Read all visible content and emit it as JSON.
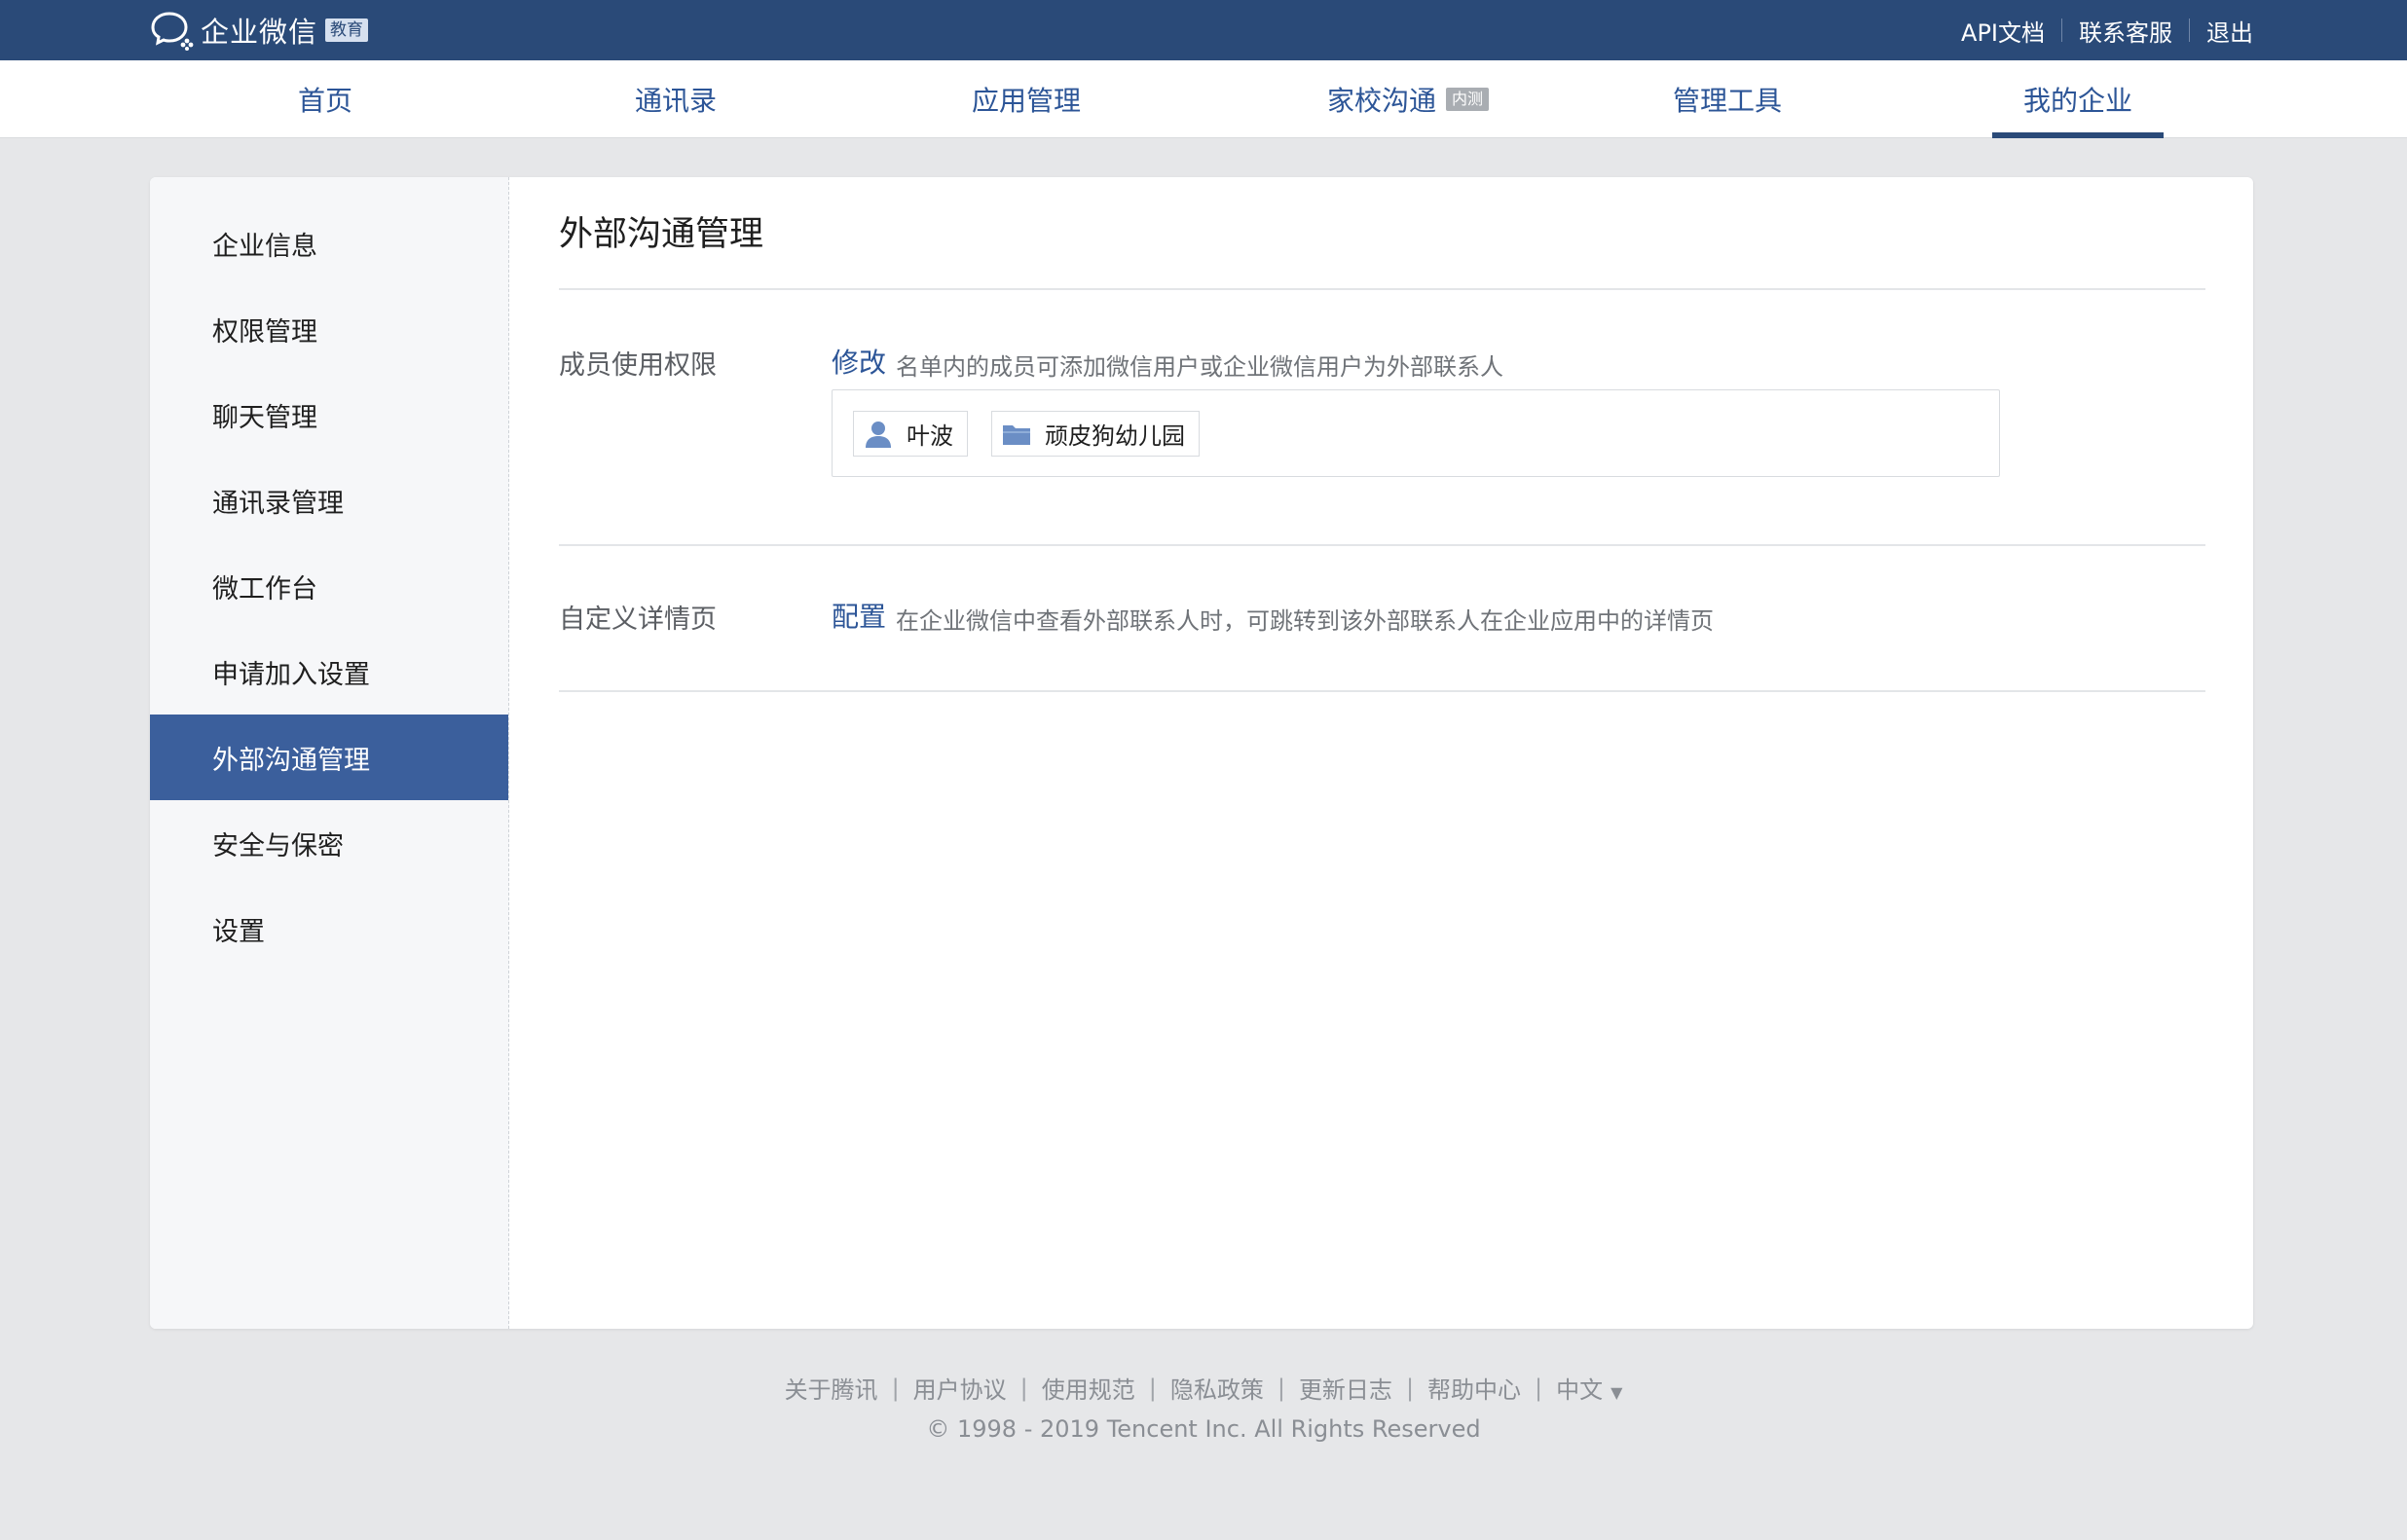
{
  "header": {
    "brand_name": "企业微信",
    "brand_badge": "教育",
    "links": [
      "API文档",
      "联系客服",
      "退出"
    ]
  },
  "nav": {
    "tabs": [
      {
        "label": "首页",
        "tag": ""
      },
      {
        "label": "通讯录",
        "tag": ""
      },
      {
        "label": "应用管理",
        "tag": ""
      },
      {
        "label": "家校沟通",
        "tag": "内测"
      },
      {
        "label": "管理工具",
        "tag": ""
      },
      {
        "label": "我的企业",
        "tag": ""
      }
    ],
    "active_tab": "我的企业"
  },
  "sidebar": {
    "items": [
      {
        "label": "企业信息"
      },
      {
        "label": "权限管理"
      },
      {
        "label": "聊天管理"
      },
      {
        "label": "通讯录管理"
      },
      {
        "label": "微工作台"
      },
      {
        "label": "申请加入设置"
      },
      {
        "label": "外部沟通管理"
      },
      {
        "label": "安全与保密"
      },
      {
        "label": "设置"
      }
    ],
    "active_item": "外部沟通管理"
  },
  "main": {
    "title": "外部沟通管理",
    "member_permission": {
      "label": "成员使用权限",
      "action": "修改",
      "description": "名单内的成员可添加微信用户或企业微信用户为外部联系人",
      "members": [
        {
          "name": "叶波",
          "icon": "person-icon"
        },
        {
          "name": "顽皮狗幼儿园",
          "icon": "folder-icon"
        }
      ]
    },
    "custom_detail": {
      "label": "自定义详情页",
      "action": "配置",
      "description": "在企业微信中查看外部联系人时，可跳转到该外部联系人在企业应用中的详情页"
    }
  },
  "footer": {
    "links": [
      "关于腾讯",
      "用户协议",
      "使用规范",
      "隐私政策",
      "更新日志",
      "帮助中心"
    ],
    "language": "中文",
    "copyright": "© 1998 - 2019 Tencent Inc. All Rights Reserved"
  },
  "colors": {
    "topbar": "#2a4a78",
    "accent": "#2c5597",
    "sidebar_active": "#3b5f9c",
    "page_bg": "#e6e7e9"
  }
}
